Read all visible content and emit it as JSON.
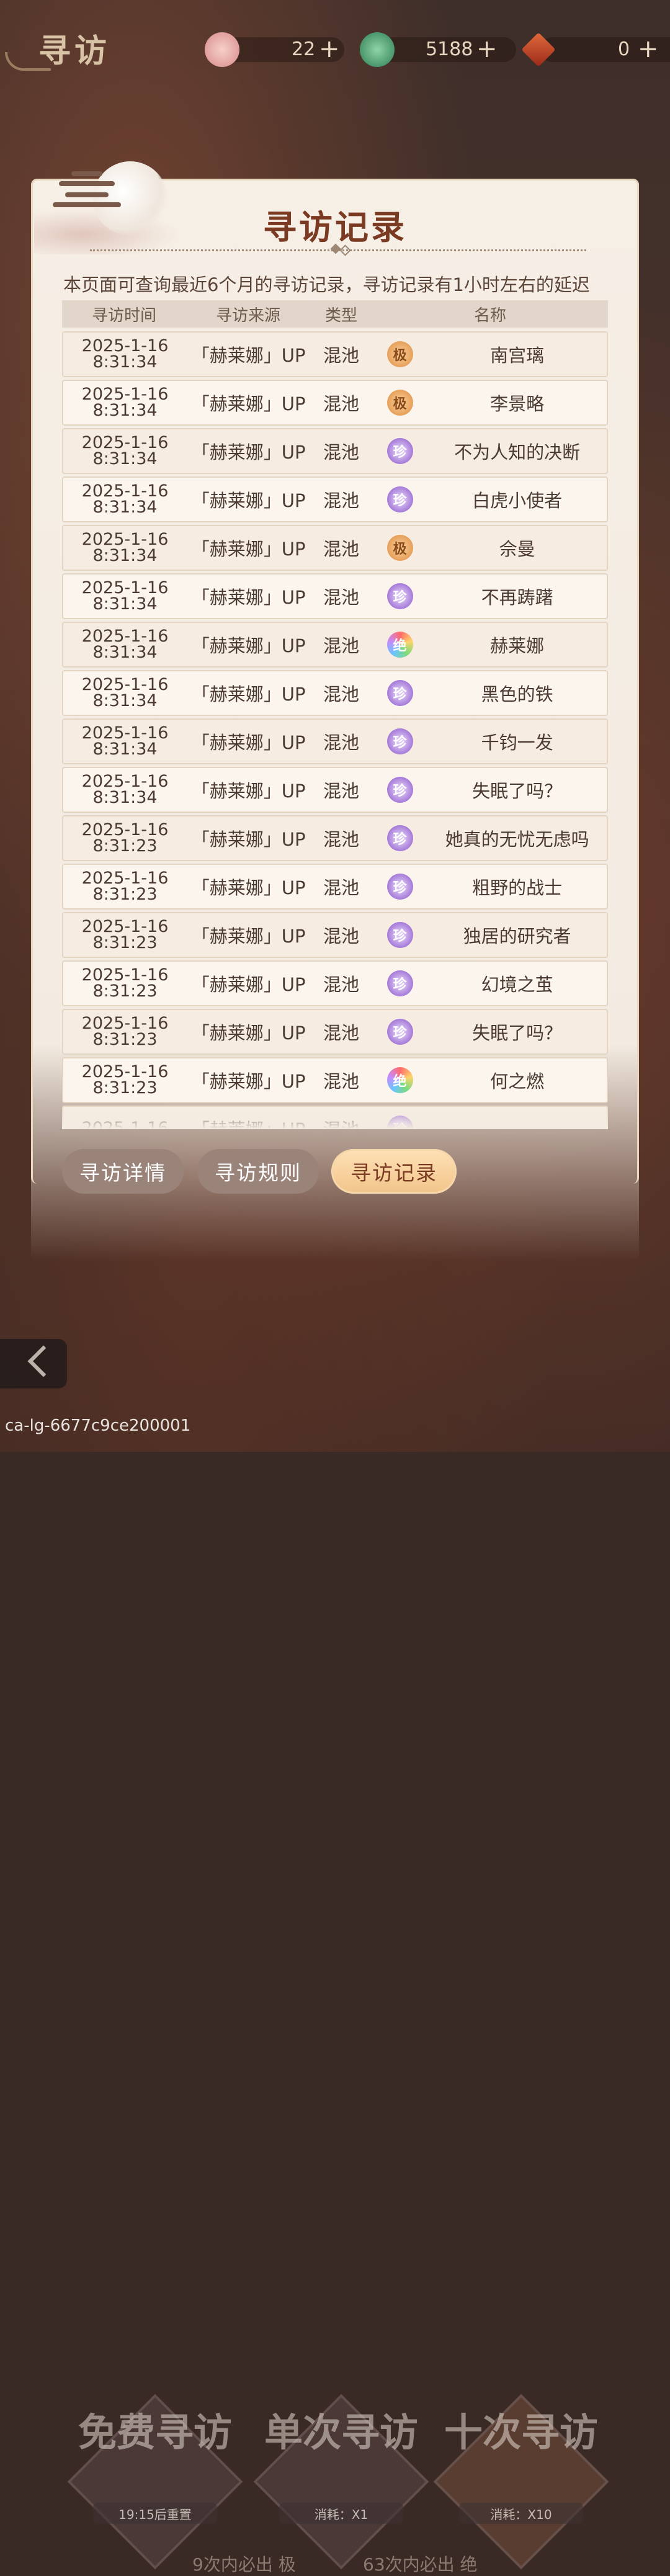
{
  "header": {
    "title": "寻访",
    "resources": [
      {
        "icon": "gem-icon",
        "value": "22",
        "plus": "+",
        "color": "#e8a0a8"
      },
      {
        "icon": "jade-icon",
        "value": "5188",
        "plus": "+",
        "color": "#3f9a6a"
      },
      {
        "icon": "ticket-icon",
        "value": "0",
        "plus": "+",
        "color": "#c24a2a"
      }
    ]
  },
  "dialog": {
    "title": "寻访记录",
    "notice": "本页面可查询最近6个月的寻访记录，寻访记录有1小时左右的延迟",
    "columns": [
      "寻访时间",
      "寻访来源",
      "类型",
      "名称"
    ],
    "records": [
      {
        "date": "2025-1-16",
        "time": "8:31:34",
        "source": "「赫莱娜」UP",
        "type": "混池",
        "rarity": "极",
        "rarity_class": "r-ji",
        "name": "南宫璃"
      },
      {
        "date": "2025-1-16",
        "time": "8:31:34",
        "source": "「赫莱娜」UP",
        "type": "混池",
        "rarity": "极",
        "rarity_class": "r-ji",
        "name": "李景略"
      },
      {
        "date": "2025-1-16",
        "time": "8:31:34",
        "source": "「赫莱娜」UP",
        "type": "混池",
        "rarity": "珍",
        "rarity_class": "r-zhen",
        "name": "不为人知的决断"
      },
      {
        "date": "2025-1-16",
        "time": "8:31:34",
        "source": "「赫莱娜」UP",
        "type": "混池",
        "rarity": "珍",
        "rarity_class": "r-zhen",
        "name": "白虎小使者"
      },
      {
        "date": "2025-1-16",
        "time": "8:31:34",
        "source": "「赫莱娜」UP",
        "type": "混池",
        "rarity": "极",
        "rarity_class": "r-ji",
        "name": "佘曼"
      },
      {
        "date": "2025-1-16",
        "time": "8:31:34",
        "source": "「赫莱娜」UP",
        "type": "混池",
        "rarity": "珍",
        "rarity_class": "r-zhen",
        "name": "不再踌躇"
      },
      {
        "date": "2025-1-16",
        "time": "8:31:34",
        "source": "「赫莱娜」UP",
        "type": "混池",
        "rarity": "绝",
        "rarity_class": "r-jue",
        "name": "赫莱娜"
      },
      {
        "date": "2025-1-16",
        "time": "8:31:34",
        "source": "「赫莱娜」UP",
        "type": "混池",
        "rarity": "珍",
        "rarity_class": "r-zhen",
        "name": "黑色的铁"
      },
      {
        "date": "2025-1-16",
        "time": "8:31:34",
        "source": "「赫莱娜」UP",
        "type": "混池",
        "rarity": "珍",
        "rarity_class": "r-zhen",
        "name": "千钧一发"
      },
      {
        "date": "2025-1-16",
        "time": "8:31:34",
        "source": "「赫莱娜」UP",
        "type": "混池",
        "rarity": "珍",
        "rarity_class": "r-zhen",
        "name": "失眠了吗？"
      },
      {
        "date": "2025-1-16",
        "time": "8:31:23",
        "source": "「赫莱娜」UP",
        "type": "混池",
        "rarity": "珍",
        "rarity_class": "r-zhen",
        "name": "她真的无忧无虑吗"
      },
      {
        "date": "2025-1-16",
        "time": "8:31:23",
        "source": "「赫莱娜」UP",
        "type": "混池",
        "rarity": "珍",
        "rarity_class": "r-zhen",
        "name": "粗野的战士"
      },
      {
        "date": "2025-1-16",
        "time": "8:31:23",
        "source": "「赫莱娜」UP",
        "type": "混池",
        "rarity": "珍",
        "rarity_class": "r-zhen",
        "name": "独居的研究者"
      },
      {
        "date": "2025-1-16",
        "time": "8:31:23",
        "source": "「赫莱娜」UP",
        "type": "混池",
        "rarity": "珍",
        "rarity_class": "r-zhen",
        "name": "幻境之茧"
      },
      {
        "date": "2025-1-16",
        "time": "8:31:23",
        "source": "「赫莱娜」UP",
        "type": "混池",
        "rarity": "珍",
        "rarity_class": "r-zhen",
        "name": "失眠了吗？"
      },
      {
        "date": "2025-1-16",
        "time": "8:31:23",
        "source": "「赫莱娜」UP",
        "type": "混池",
        "rarity": "绝",
        "rarity_class": "r-jue",
        "name": "何之燃"
      },
      {
        "date": "2025-1-16",
        "time": "",
        "source": "「赫莱娜」UP",
        "type": "混池",
        "rarity": "珍",
        "rarity_class": "r-zhen",
        "name": ""
      }
    ]
  },
  "tabs": [
    {
      "label": "寻访详情",
      "active": false
    },
    {
      "label": "寻访规则",
      "active": false
    },
    {
      "label": "寻访记录",
      "active": true
    }
  ],
  "actions": {
    "free": {
      "label": "免费寻访",
      "sub": "19:15后重置"
    },
    "single": {
      "label": "单次寻访",
      "sub": "消耗：X1"
    },
    "ten": {
      "label": "十次寻访",
      "sub": "消耗：X10"
    }
  },
  "guarantees": {
    "left": "9次内必出",
    "left_rarity": "极",
    "right": "63次内必出",
    "right_rarity": "绝"
  },
  "watermark": "ca-lg-6677c9ce200001"
}
